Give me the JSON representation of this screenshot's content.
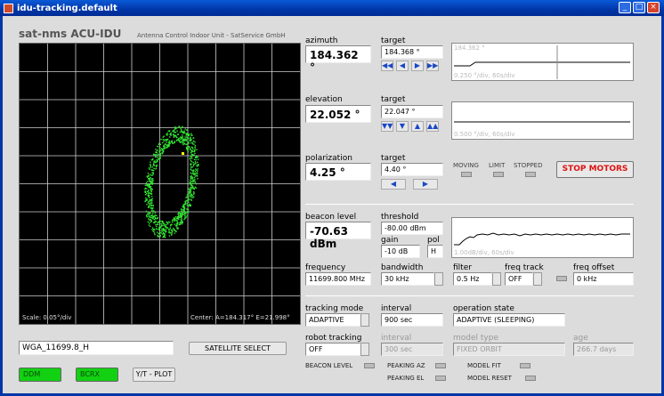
{
  "window": {
    "title": "idu-tracking.default",
    "buttons": [
      "_",
      "□",
      "×"
    ]
  },
  "header": {
    "app_title": "sat-nms ACU-IDU",
    "subtitle": "Antenna Control Indoor Unit - SatService GmbH"
  },
  "plot": {
    "scale": "Scale: 0.05°/div",
    "center": "Center: A=184.317° E=21.998°"
  },
  "azimuth": {
    "label": "azimuth",
    "value": "184.362 °",
    "target_label": "target",
    "target": "184.368 °",
    "buttons": [
      "◀◀",
      "◀",
      "▶",
      "▶▶"
    ],
    "graph_top": "184.362 °",
    "graph_bottom": "0.250 °/div, 60s/div"
  },
  "elevation": {
    "label": "elevation",
    "value": "22.052 °",
    "target_label": "target",
    "target": "22.047 °",
    "buttons": [
      "▼▼",
      "▼",
      "▲",
      "▲▲"
    ],
    "graph_bottom": "0.500 °/div, 60s/div"
  },
  "polarization": {
    "label": "polarization",
    "value": "4.25 °",
    "target_label": "target",
    "target": "4.40 °",
    "buttons": [
      "◀",
      "▶"
    ]
  },
  "status": {
    "moving": "MOVING",
    "limit": "LIMIT",
    "stopped": "STOPPED",
    "stop_button": "STOP MOTORS"
  },
  "beacon": {
    "label": "beacon level",
    "value": "-70.63 dBm",
    "threshold_label": "threshold",
    "threshold": "-80.00 dBm",
    "gain_label": "gain",
    "gain": "-10 dB",
    "pol_label": "pol",
    "pol": "H",
    "graph_bottom": "1.00dB/div, 60s/div"
  },
  "rx": {
    "frequency_label": "frequency",
    "frequency": "11699.800 MHz",
    "bandwidth_label": "bandwidth",
    "bandwidth": "30 kHz",
    "filter_label": "filter",
    "filter": "0.5 Hz",
    "freq_track_label": "freq track",
    "freq_track": "OFF",
    "freq_offset_label": "freq offset",
    "freq_offset": "0 kHz"
  },
  "tracking": {
    "mode_label": "tracking mode",
    "mode": "ADAPTIVE",
    "interval_label": "interval",
    "interval": "900 sec",
    "state_label": "operation state",
    "state": "ADAPTIVE (SLEEPING)",
    "robot_label": "robot tracking",
    "robot": "OFF",
    "interval2_label": "interval",
    "interval2": "300 sec",
    "model_type_label": "model type",
    "model_type": "FIXED ORBIT",
    "age_label": "age",
    "age": "266.7 days"
  },
  "satellite": {
    "name": "WGA_11699.8_H",
    "select_button": "SATELLITE SELECT"
  },
  "bottom": {
    "ddm": "DDM",
    "bcrx": "BCRX",
    "yt_plot": "Y/T - PLOT",
    "beacon_level": "BEACON LEVEL",
    "peaking_az": "PEAKING AZ",
    "peaking_el": "PEAKING EL",
    "model_fit": "MODEL FIT",
    "model_reset": "MODEL RESET"
  },
  "colors": {
    "plot_points": "#33e833",
    "stop_text": "#e01010",
    "green_button": "#12d012"
  }
}
